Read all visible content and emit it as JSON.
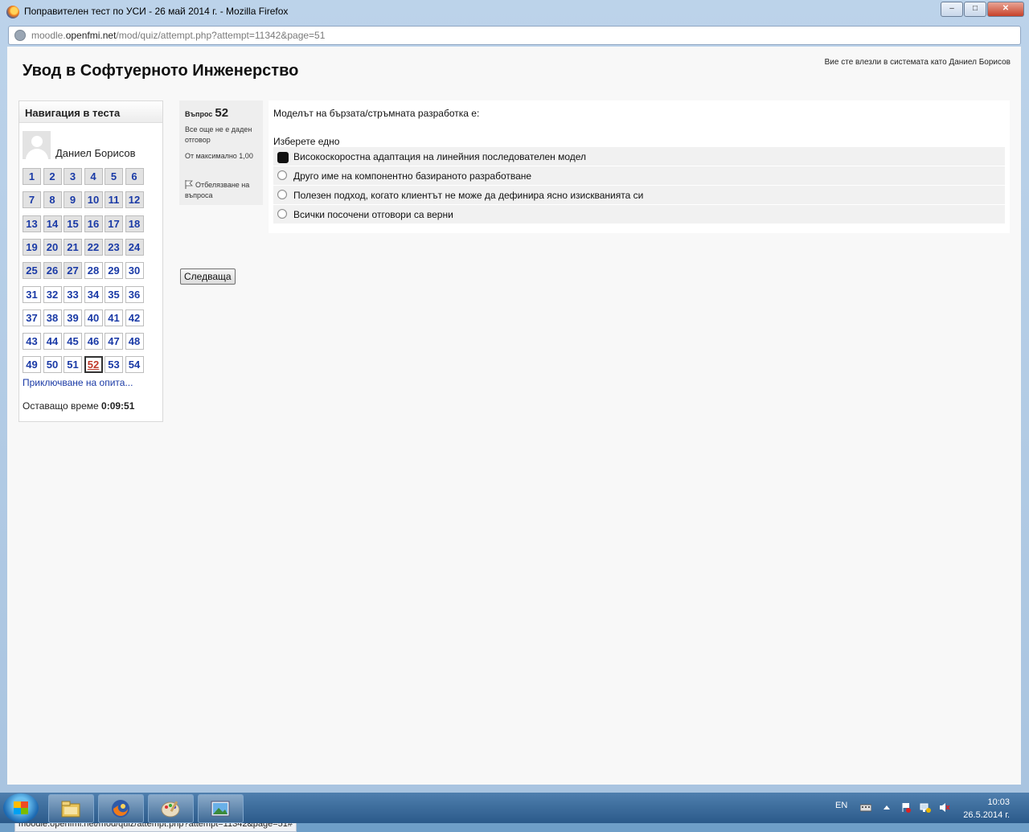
{
  "window": {
    "title": "Поправителен тест по УСИ - 26 май 2014 г. - Mozilla Firefox",
    "url_domain": "moodle.openfmi.net",
    "url_prefix": "moodle.",
    "url_host": "openfmi.net",
    "url_path": "/mod/quiz/attempt.php?attempt=11342&page=51"
  },
  "page": {
    "course_title": "Увод в Софтуерното Инженерство",
    "login_info": "Вие сте влезли в системата като Даниел Борисов"
  },
  "nav": {
    "heading": "Навигация в теста",
    "user_name": "Даниел Борисов",
    "questions": [
      {
        "n": "1",
        "state": "answered"
      },
      {
        "n": "2",
        "state": "answered"
      },
      {
        "n": "3",
        "state": "answered"
      },
      {
        "n": "4",
        "state": "answered"
      },
      {
        "n": "5",
        "state": "answered"
      },
      {
        "n": "6",
        "state": "answered"
      },
      {
        "n": "7",
        "state": "answered"
      },
      {
        "n": "8",
        "state": "answered"
      },
      {
        "n": "9",
        "state": "answered"
      },
      {
        "n": "10",
        "state": "answered"
      },
      {
        "n": "11",
        "state": "answered"
      },
      {
        "n": "12",
        "state": "answered"
      },
      {
        "n": "13",
        "state": "answered"
      },
      {
        "n": "14",
        "state": "answered"
      },
      {
        "n": "15",
        "state": "answered"
      },
      {
        "n": "16",
        "state": "answered"
      },
      {
        "n": "17",
        "state": "answered"
      },
      {
        "n": "18",
        "state": "answered"
      },
      {
        "n": "19",
        "state": "answered"
      },
      {
        "n": "20",
        "state": "answered"
      },
      {
        "n": "21",
        "state": "answered"
      },
      {
        "n": "22",
        "state": "answered"
      },
      {
        "n": "23",
        "state": "answered"
      },
      {
        "n": "24",
        "state": "answered"
      },
      {
        "n": "25",
        "state": "answered"
      },
      {
        "n": "26",
        "state": "answered"
      },
      {
        "n": "27",
        "state": "answered"
      },
      {
        "n": "28",
        "state": "unanswered"
      },
      {
        "n": "29",
        "state": "unanswered"
      },
      {
        "n": "30",
        "state": "unanswered"
      },
      {
        "n": "31",
        "state": "unanswered"
      },
      {
        "n": "32",
        "state": "unanswered"
      },
      {
        "n": "33",
        "state": "unanswered"
      },
      {
        "n": "34",
        "state": "unanswered"
      },
      {
        "n": "35",
        "state": "unanswered"
      },
      {
        "n": "36",
        "state": "unanswered"
      },
      {
        "n": "37",
        "state": "unanswered"
      },
      {
        "n": "38",
        "state": "unanswered"
      },
      {
        "n": "39",
        "state": "unanswered"
      },
      {
        "n": "40",
        "state": "unanswered"
      },
      {
        "n": "41",
        "state": "unanswered"
      },
      {
        "n": "42",
        "state": "unanswered"
      },
      {
        "n": "43",
        "state": "unanswered"
      },
      {
        "n": "44",
        "state": "unanswered"
      },
      {
        "n": "45",
        "state": "unanswered"
      },
      {
        "n": "46",
        "state": "unanswered"
      },
      {
        "n": "47",
        "state": "unanswered"
      },
      {
        "n": "48",
        "state": "unanswered"
      },
      {
        "n": "49",
        "state": "unanswered"
      },
      {
        "n": "50",
        "state": "unanswered"
      },
      {
        "n": "51",
        "state": "unanswered"
      },
      {
        "n": "52",
        "state": "current"
      },
      {
        "n": "53",
        "state": "unanswered"
      },
      {
        "n": "54",
        "state": "unanswered"
      }
    ],
    "finish_link": "Приключване на опита...",
    "timer_label": "Оставащо време",
    "timer_value": "0:09:51"
  },
  "question": {
    "label": "Въпрос",
    "number": "52",
    "state": "Все още не е даден отговор",
    "grade": "От максимално 1,00",
    "flag": "Отбелязване на въпроса",
    "text": "Моделът на бързата/стръмната разработка е:",
    "prompt": "Изберете едно",
    "options": [
      {
        "label": "Високоскоростна адаптация на линейния последователен модел",
        "checked": true
      },
      {
        "label": "Друго име на компонентно базираното разработване",
        "checked": false
      },
      {
        "label": "Полезен подход, когато клиентът не може да дефинира ясно  изискванията си",
        "checked": false
      },
      {
        "label": "Всички посочени отговори са верни",
        "checked": false
      }
    ],
    "next_button": "Следваща"
  },
  "statusbar": {
    "text": "moodle.openfmi.net/mod/quiz/attempt.php?attempt=11342&page=51#"
  },
  "taskbar": {
    "apps": [
      "windows-explorer-icon",
      "firefox-icon",
      "paint-icon",
      "photo-viewer-icon"
    ],
    "language": "EN",
    "time": "10:03",
    "date": "26.5.2014 г."
  }
}
